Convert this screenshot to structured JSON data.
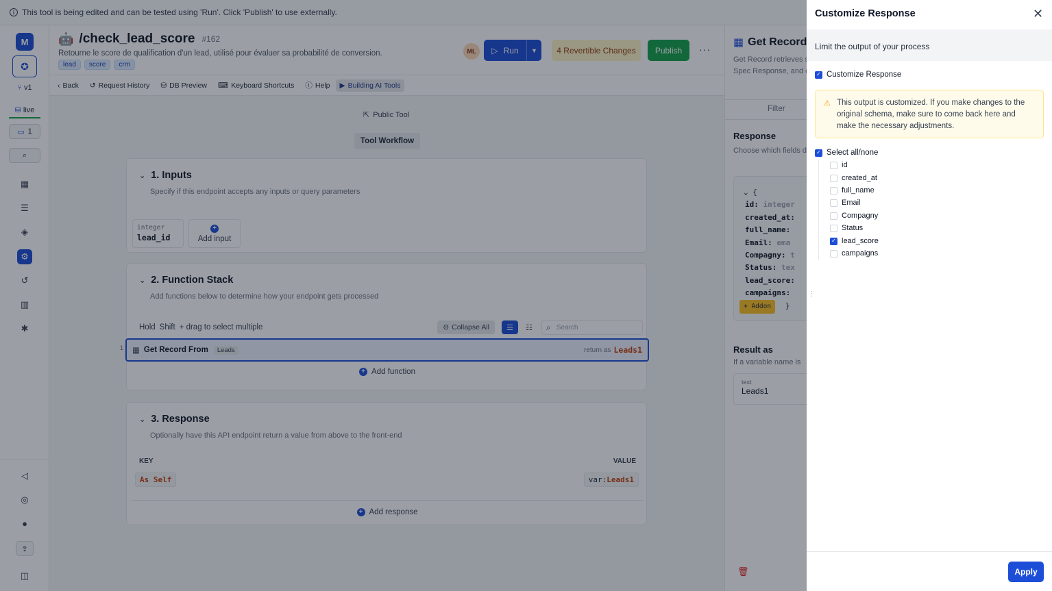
{
  "banner": {
    "text": "This tool is being edited and can be tested using 'Run'. Click 'Publish' to use externally."
  },
  "sidebar": {
    "avatar": "M",
    "version": "v1",
    "status": "live",
    "comments_count": "1"
  },
  "header": {
    "title": "/check_lead_score",
    "id": "#162",
    "description": "Retourne le score de qualification d'un lead, utilisé pour évaluer sa probabilité de conversion.",
    "tags": [
      "lead",
      "score",
      "crm"
    ],
    "user_initials": "ML",
    "run_label": "Run",
    "revertible_label": "4 Revertible Changes",
    "publish_label": "Publish"
  },
  "toolbar": {
    "back": "Back",
    "request_history": "Request History",
    "db_preview": "DB Preview",
    "shortcuts": "Keyboard Shortcuts",
    "help": "Help",
    "building": "Building AI Tools"
  },
  "canvas": {
    "public_tool": "Public Tool",
    "workflow": "Tool Workflow",
    "inputs": {
      "title": "1. Inputs",
      "desc": "Specify if this endpoint accepts any inputs or query parameters",
      "input_type": "integer",
      "input_name": "lead_id",
      "add_label": "Add input"
    },
    "functions": {
      "title": "2. Function Stack",
      "desc": "Add functions below to determine how your endpoint gets processed",
      "hold": "Hold",
      "shift": "Shift",
      "drag": "+ drag to select multiple",
      "collapse": "Collapse All",
      "search_placeholder": "Search",
      "row_index": "1",
      "row_name": "Get Record From",
      "row_table": "Leads",
      "return_as": "return as",
      "return_var": "Leads1",
      "add_label": "Add function"
    },
    "response": {
      "title": "3. Response",
      "desc": "Optionally have this API endpoint return a value from above to the front-end",
      "key_header": "KEY",
      "value_header": "VALUE",
      "key": "As Self",
      "value_prefix": "var:",
      "value_var": "Leads1",
      "add_label": "Add response"
    }
  },
  "record_panel": {
    "title": "Get Record",
    "desc": "Get Record retrieves specific value. Spec Response, and confi",
    "filter_tab": "Filter",
    "response_title": "Response",
    "response_desc": "Choose which fields data is saved in the",
    "schema": [
      {
        "key": "id:",
        "type": "integer"
      },
      {
        "key": "created_at:",
        "type": ""
      },
      {
        "key": "full_name:",
        "type": ""
      },
      {
        "key": "Email:",
        "type": "ema"
      },
      {
        "key": "Compagny:",
        "type": "t"
      },
      {
        "key": "Status:",
        "type": "tex"
      },
      {
        "key": "lead_score:",
        "type": ""
      },
      {
        "key": "campaigns:",
        "type": ""
      }
    ],
    "addon_label": "Addon",
    "result_title": "Result as",
    "result_desc": "If a variable name is",
    "var_type": "text",
    "var_value": "Leads1"
  },
  "drawer": {
    "title": "Customize Response",
    "subtitle": "Limit the output of your process",
    "customize_label": "Customize Response",
    "warning": "This output is customized. If you make changes to the original schema, make sure to come back here and make the necessary adjustments.",
    "select_all_label": "Select all/none",
    "fields": [
      {
        "label": "id",
        "checked": false
      },
      {
        "label": "created_at",
        "checked": false
      },
      {
        "label": "full_name",
        "checked": false
      },
      {
        "label": "Email",
        "checked": false
      },
      {
        "label": "Compagny",
        "checked": false
      },
      {
        "label": "Status",
        "checked": false
      },
      {
        "label": "lead_score",
        "checked": true
      },
      {
        "label": "campaigns",
        "checked": false
      }
    ],
    "apply_label": "Apply"
  },
  "colors": {
    "primary": "#1d4ed8",
    "success": "#16a34a",
    "warning_bg": "#fffbeb"
  }
}
